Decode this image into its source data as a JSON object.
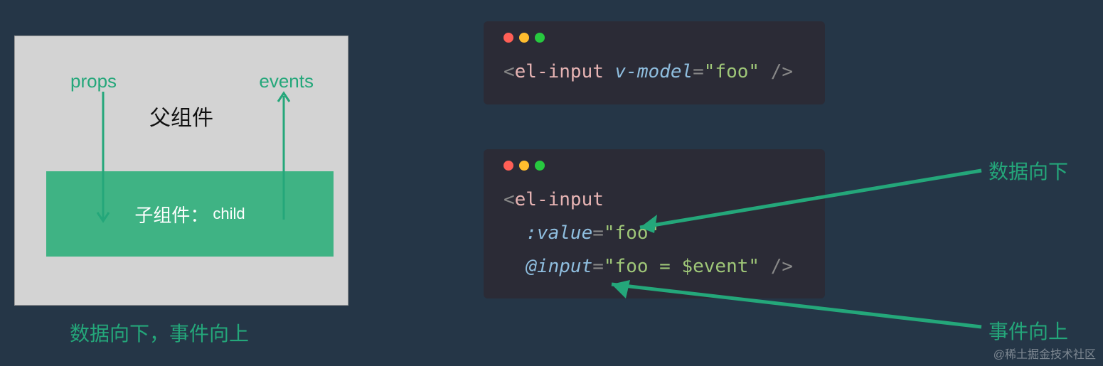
{
  "left": {
    "props_label": "props",
    "events_label": "events",
    "parent_label": "父组件",
    "child_label_cn": "子组件：",
    "child_label_en": "child",
    "caption": "数据向下，事件向上"
  },
  "code1": {
    "tag": "el-input",
    "attr": "v-model",
    "val": "\"foo\""
  },
  "code2": {
    "tag": "el-input",
    "attr1": ":value",
    "val1": "\"foo\"",
    "attr2": "@input",
    "val2": "\"foo = $event\""
  },
  "annotations": {
    "data_down": "数据向下",
    "event_up": "事件向上"
  },
  "watermark": "@稀土掘金技术社区"
}
